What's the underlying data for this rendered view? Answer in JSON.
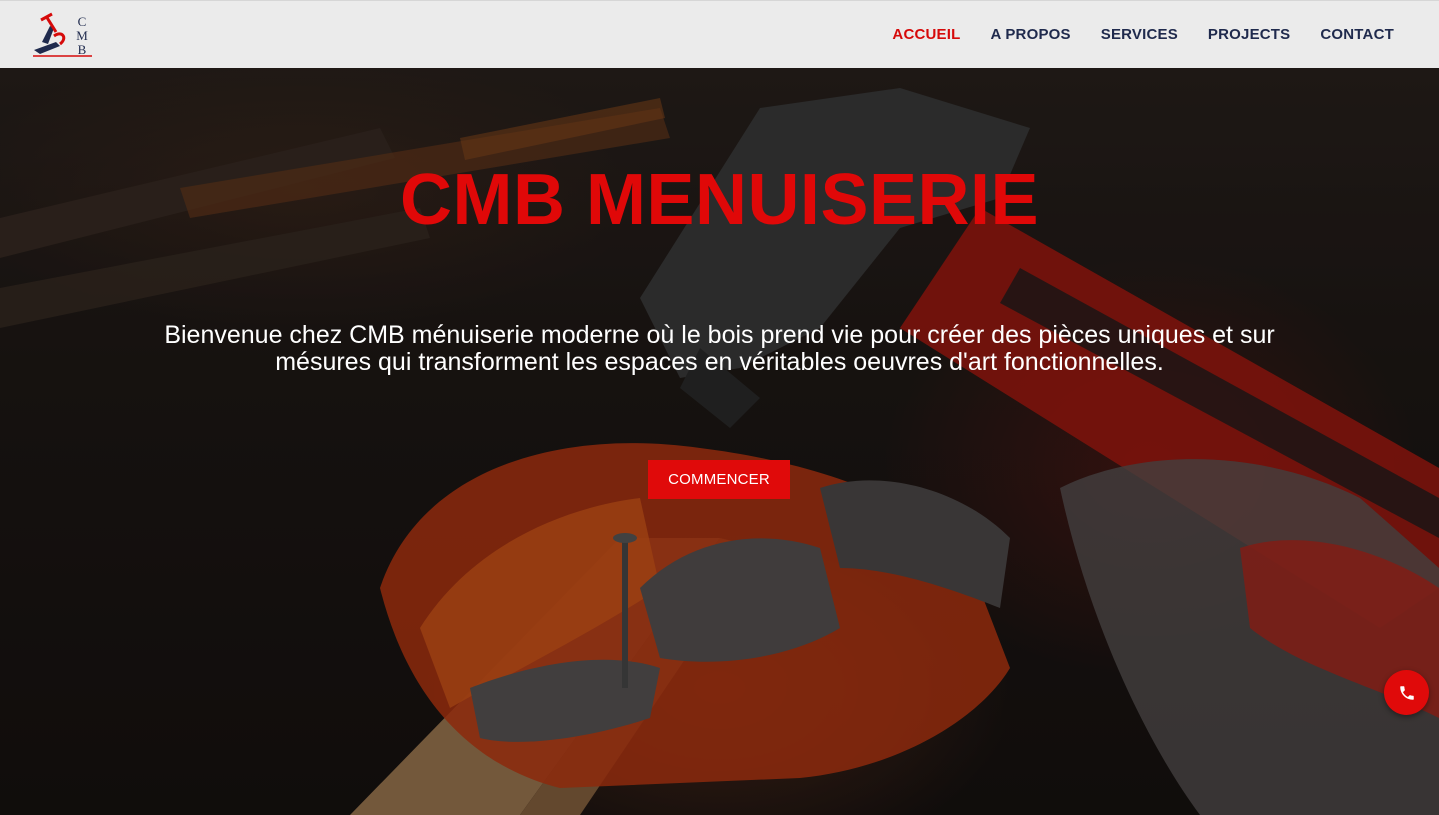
{
  "logo": {
    "text": "CMB"
  },
  "nav": {
    "items": [
      {
        "label": "ACCUEIL",
        "active": true
      },
      {
        "label": "A PROPOS",
        "active": false
      },
      {
        "label": "SERVICES",
        "active": false
      },
      {
        "label": "PROJECTS",
        "active": false
      },
      {
        "label": "CONTACT",
        "active": false
      }
    ]
  },
  "hero": {
    "title": "CMB MENUISERIE",
    "text": "Bienvenue chez CMB ménuiserie moderne où le bois prend vie pour créer des pièces uniques et sur mésures qui transforment les espaces en véritables oeuvres d'art fonctionnelles.",
    "cta_label": "COMMENCER"
  },
  "floating": {
    "icon": "phone-icon"
  },
  "colors": {
    "accent": "#e00a0a",
    "nav_text": "#1f2a4d",
    "header_bg": "#ebebeb"
  }
}
